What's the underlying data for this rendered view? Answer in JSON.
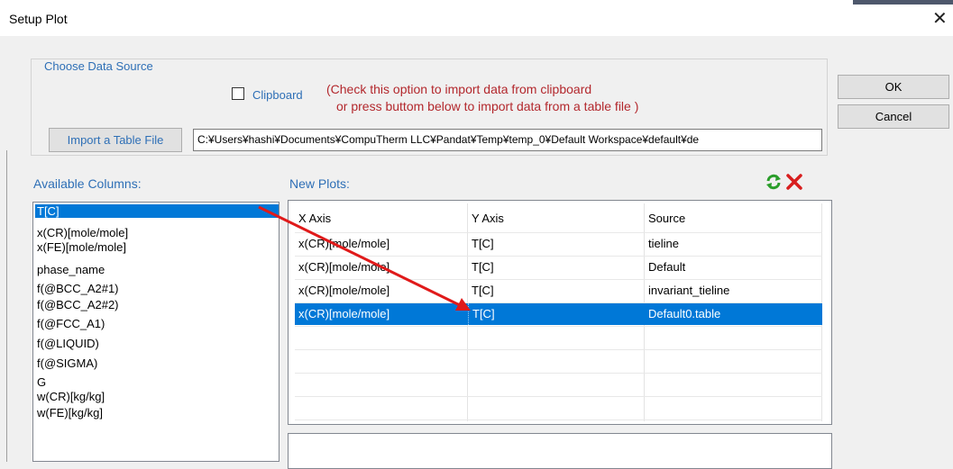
{
  "window": {
    "title": "Setup Plot",
    "close_glyph": "✕"
  },
  "data_source": {
    "legend": "Choose Data Source",
    "clipboard_label": "Clipboard",
    "clipboard_checked": false,
    "note_line1": "(Check this option to import data from clipboard",
    "note_line2": "or press buttom below to import data from a table file )",
    "import_button": "Import a Table File",
    "file_path": "C:¥Users¥hashi¥Documents¥CompuTherm LLC¥Pandat¥Temp¥temp_0¥Default Workspace¥default¥de"
  },
  "buttons": {
    "ok": "OK",
    "cancel": "Cancel"
  },
  "available": {
    "label": "Available Columns:",
    "items": [
      "T[C]",
      "x(CR)[mole/mole]",
      "x(FE)[mole/mole]",
      "phase_name",
      "f(@BCC_A2#1)",
      "f(@BCC_A2#2)",
      "f(@FCC_A1)",
      "f(@LIQUID)",
      "f(@SIGMA)",
      "G",
      "w(CR)[kg/kg]",
      "w(FE)[kg/kg]"
    ],
    "selected_index": 0
  },
  "new_plots": {
    "label": "New Plots:",
    "headers": [
      "X Axis",
      "Y Axis",
      "Source"
    ],
    "rows": [
      [
        "x(CR)[mole/mole]",
        "T[C]",
        "tieline"
      ],
      [
        "x(CR)[mole/mole]",
        "T[C]",
        "Default"
      ],
      [
        "x(CR)[mole/mole]",
        "T[C]",
        "invariant_tieline"
      ],
      [
        "x(CR)[mole/mole]",
        "T[C]",
        "Default0.table"
      ]
    ],
    "selected_row": 3
  },
  "toolbar_icons": {
    "refresh": "refresh-icon",
    "delete": "delete-x-icon"
  },
  "colors": {
    "accent_blue": "#2e6fb6",
    "selection": "#0078d7",
    "note_red": "#b3282d",
    "arrow_red": "#e01a1a"
  }
}
